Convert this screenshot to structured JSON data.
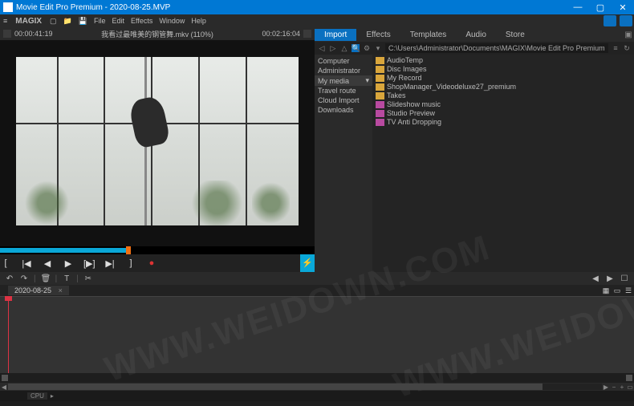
{
  "window": {
    "title": "Movie Edit Pro Premium - 2020-08-25.MVP"
  },
  "brand": "MAGIX",
  "menu": {
    "file": "File",
    "edit": "Edit",
    "effects": "Effects",
    "window": "Window",
    "help": "Help"
  },
  "preview": {
    "timecode_left": "00:00:41:19",
    "clip_title": "我看过最唯美的钢管舞.mkv  (110%)",
    "timecode_right": "00:02:16:04"
  },
  "transport": {
    "in": "[",
    "start": "|◀",
    "prev": "◀",
    "play": "▶",
    "next": "[▶]",
    "end": "▶|",
    "out": "]",
    "rec": "●",
    "flash": "⚡"
  },
  "media_tabs": {
    "import": "Import",
    "effects": "Effects",
    "templates": "Templates",
    "audio": "Audio",
    "store": "Store"
  },
  "pathbar": {
    "path": "C:\\Users\\Administrator\\Documents\\MAGIX\\Movie Edit Pro Premium"
  },
  "tree": {
    "items": [
      {
        "label": "Computer"
      },
      {
        "label": "Administrator"
      },
      {
        "label": "My media",
        "expand": "▾"
      },
      {
        "label": "Travel route"
      },
      {
        "label": "Cloud Import"
      },
      {
        "label": "Downloads"
      }
    ]
  },
  "folders": [
    {
      "label": "AudioTemp",
      "mag": false
    },
    {
      "label": "Disc Images",
      "mag": false
    },
    {
      "label": "My Record",
      "mag": false
    },
    {
      "label": "ShopManager_Videodeluxe27_premium",
      "mag": false
    },
    {
      "label": "Takes",
      "mag": false
    },
    {
      "label": "Slideshow music",
      "mag": true
    },
    {
      "label": "Studio Preview",
      "mag": true
    },
    {
      "label": "TV Anti Dropping",
      "mag": true
    }
  ],
  "toolbar": {
    "undo": "↶",
    "redo": "↷",
    "cut": "|",
    "trash": "🗑",
    "title": "T",
    "razor": "✂",
    "left": "◀",
    "right": "▶",
    "boxes": "☐"
  },
  "timeline": {
    "tab": "2020-08-25",
    "close": "×"
  },
  "status": {
    "cpu": "CPU",
    "arrow": "▸"
  }
}
